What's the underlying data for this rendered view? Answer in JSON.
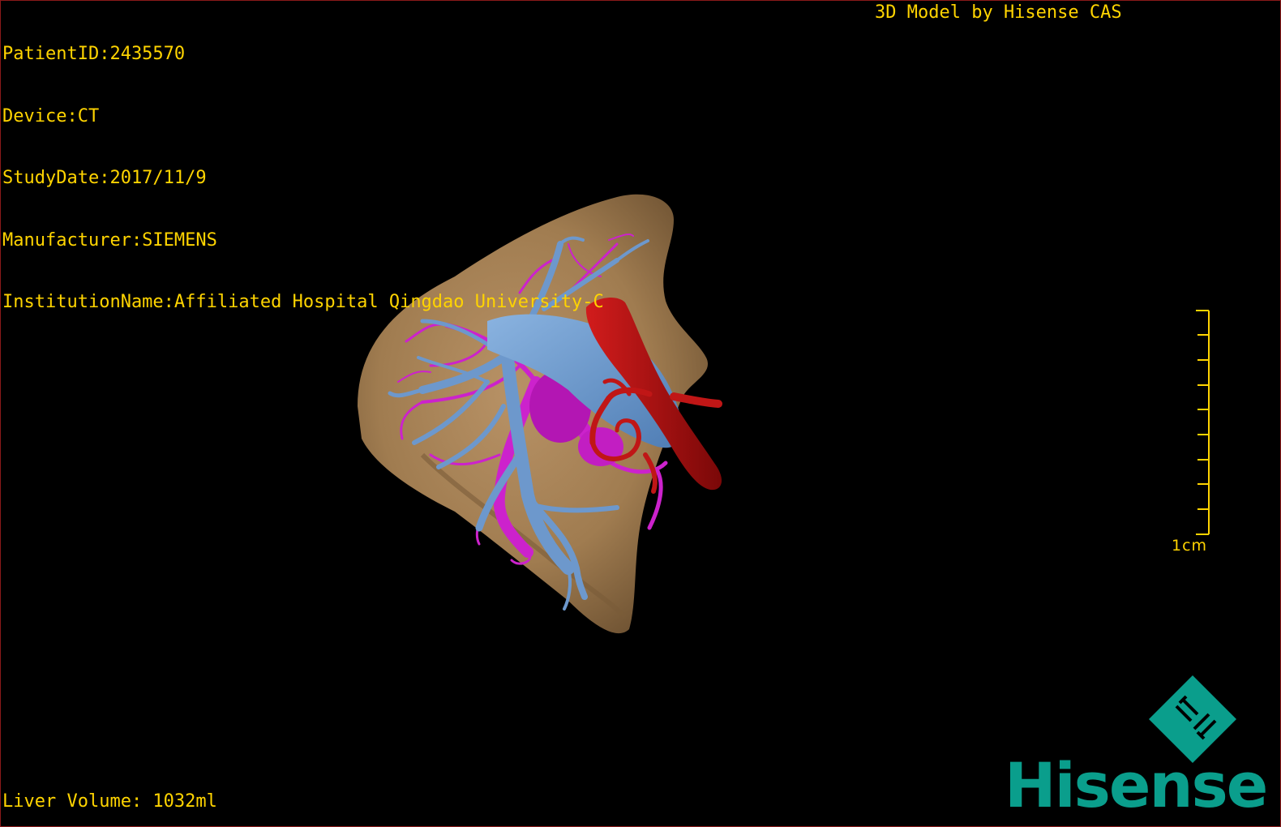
{
  "overlay": {
    "patient_id": "PatientID:2435570",
    "device": "Device:CT",
    "study_date": "StudyDate:2017/11/9",
    "manufacturer": "Manufacturer:SIEMENS",
    "institution": "InstitutionName:Affiliated Hospital Qingdao University-C",
    "model_credit": "3D Model by Hisense CAS",
    "liver_volume": "Liver Volume: 1032ml"
  },
  "scale": {
    "label": "1cm",
    "tick_count": 10
  },
  "logo": {
    "brand": "Hisense",
    "mark_glyph": "H"
  },
  "colors": {
    "overlay_text": "#ffd400",
    "liver": "#a8865a",
    "portal_vein": "#6d98cc",
    "hepatic_vein": "#cc22cc",
    "artery": "#b31212",
    "brand": "#0a9e8c",
    "frame": "#8a1a1a"
  },
  "icons": {
    "brand_mark": "hisense-logo-icon"
  }
}
